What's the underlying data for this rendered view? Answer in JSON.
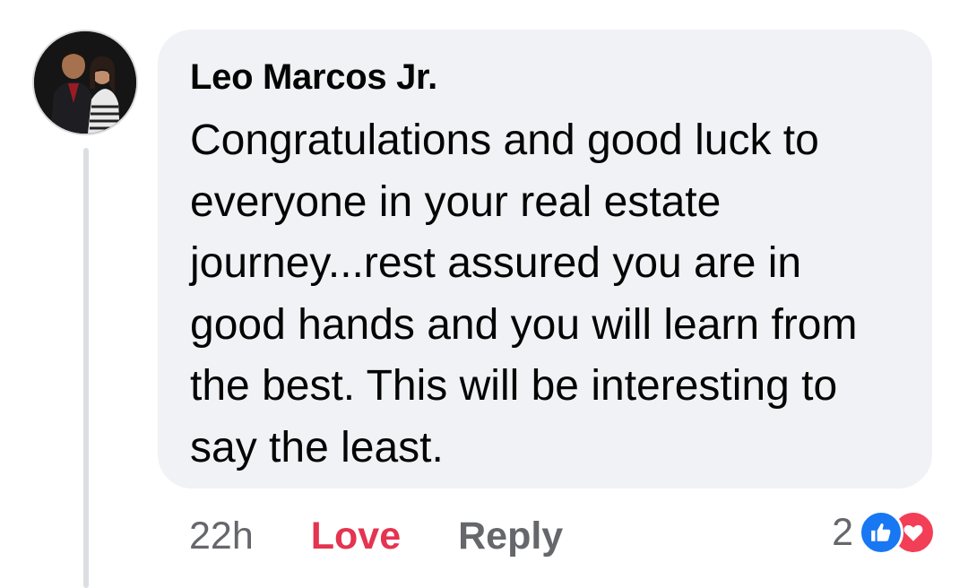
{
  "comment": {
    "author": "Leo Marcos Jr.",
    "text": "Congratulations and good luck to everyone in your real estate journey...rest assured you are in good hands and you will learn from the best. This will be interesting to say the least.",
    "timestamp": "22h",
    "reacted": true,
    "reaction_type": "Love"
  },
  "actions": {
    "love_label": "Love",
    "reply_label": "Reply"
  },
  "reactions": {
    "count": "2",
    "icons": [
      "like-icon",
      "heart-icon"
    ]
  },
  "colors": {
    "bubble_bg": "#f0f2f5",
    "love_red": "#e4344f",
    "like_blue": "#1877f2",
    "heart_red": "#f33e58",
    "meta_gray": "#65676b"
  }
}
